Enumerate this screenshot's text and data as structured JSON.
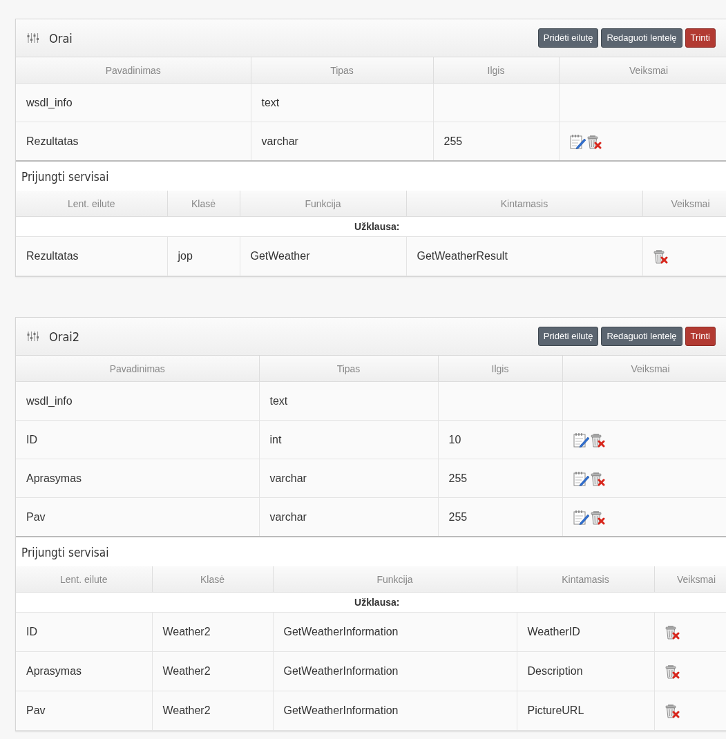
{
  "panels": [
    {
      "title": "Orai",
      "buttons": [
        {
          "label": "Pridėti eilutę",
          "kind": "default"
        },
        {
          "label": "Redaguoti lentelę",
          "kind": "default"
        },
        {
          "label": "Trinti",
          "kind": "danger"
        }
      ],
      "columns": [
        "Pavadinimas",
        "Tipas",
        "Ilgis",
        "Veiksmai"
      ],
      "rows": [
        {
          "cells": [
            "wsdl_info",
            "text",
            ""
          ]
        },
        {
          "cells": [
            "Rezultatas",
            "varchar",
            "255"
          ],
          "actions": [
            {
              "kind": "edit"
            },
            {
              "kind": "delete"
            }
          ]
        }
      ],
      "services": {
        "title": "Prijungti servisai",
        "columns": [
          "Lent. eilute",
          "Klasė",
          "Funkcija",
          "Kintamasis",
          "Veiksmai"
        ],
        "group": "Užklausa:",
        "rows": [
          {
            "cells": [
              "Rezultatas",
              "jop",
              "GetWeather",
              "GetWeatherResult"
            ],
            "actions": [
              {
                "kind": "delete"
              }
            ]
          }
        ]
      }
    },
    {
      "title": "Orai2",
      "buttons": [
        {
          "label": "Pridėti eilutę",
          "kind": "default"
        },
        {
          "label": "Redaguoti lentelę",
          "kind": "default"
        },
        {
          "label": "Trinti",
          "kind": "danger"
        }
      ],
      "columns": [
        "Pavadinimas",
        "Tipas",
        "Ilgis",
        "Veiksmai"
      ],
      "rows": [
        {
          "cells": [
            "wsdl_info",
            "text",
            ""
          ]
        },
        {
          "cells": [
            "ID",
            "int",
            "10"
          ],
          "actions": [
            {
              "kind": "edit"
            },
            {
              "kind": "delete"
            }
          ]
        },
        {
          "cells": [
            "Aprasymas",
            "varchar",
            "255"
          ],
          "actions": [
            {
              "kind": "edit"
            },
            {
              "kind": "delete"
            }
          ]
        },
        {
          "cells": [
            "Pav",
            "varchar",
            "255"
          ],
          "actions": [
            {
              "kind": "edit"
            },
            {
              "kind": "delete"
            }
          ]
        }
      ],
      "services": {
        "title": "Prijungti servisai",
        "columns": [
          "Lent. eilute",
          "Klasė",
          "Funkcija",
          "Kintamasis",
          "Veiksmai"
        ],
        "group": "Užklausa:",
        "rows": [
          {
            "cells": [
              "ID",
              "Weather2",
              "GetWeatherInformation",
              "WeatherID"
            ],
            "actions": [
              {
                "kind": "delete"
              }
            ]
          },
          {
            "cells": [
              "Aprasymas",
              "Weather2",
              "GetWeatherInformation",
              "Description"
            ],
            "actions": [
              {
                "kind": "delete"
              }
            ]
          },
          {
            "cells": [
              "Pav",
              "Weather2",
              "GetWeatherInformation",
              "PictureURL"
            ],
            "actions": [
              {
                "kind": "delete"
              }
            ]
          }
        ]
      }
    }
  ]
}
